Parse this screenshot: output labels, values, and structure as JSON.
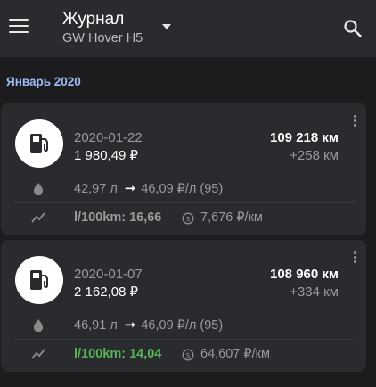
{
  "appbar": {
    "title": "Журнал",
    "subtitle": "GW Hover H5",
    "icons": {
      "menu": "menu-icon",
      "dropdown": "dropdown-icon",
      "search": "search-icon"
    }
  },
  "month_header": "Январь 2020",
  "entries": [
    {
      "date": "2020-01-22",
      "cost": "1 980,49 ₽",
      "odometer": "109 218 км",
      "distance": "+258 км",
      "volume": "42,97 л",
      "price": "46,09 ₽/л (95)",
      "consumption": "l/100km: 16,66",
      "cost_per_km": "7,676 ₽/км",
      "consumption_color": "#9a9a9a"
    },
    {
      "date": "2020-01-07",
      "cost": "2 162,08 ₽",
      "odometer": "108 960 км",
      "distance": "+334 км",
      "volume": "46,91 л",
      "price": "46,09 ₽/л (95)",
      "consumption": "l/100km: 14,04",
      "cost_per_km": "64,607 ₽/км",
      "consumption_color": "#56b35a"
    }
  ],
  "colors": {
    "background": "#1c1c1e",
    "card": "#2a2b2e",
    "accent_header": "#9bbcf5",
    "good": "#56b35a"
  }
}
